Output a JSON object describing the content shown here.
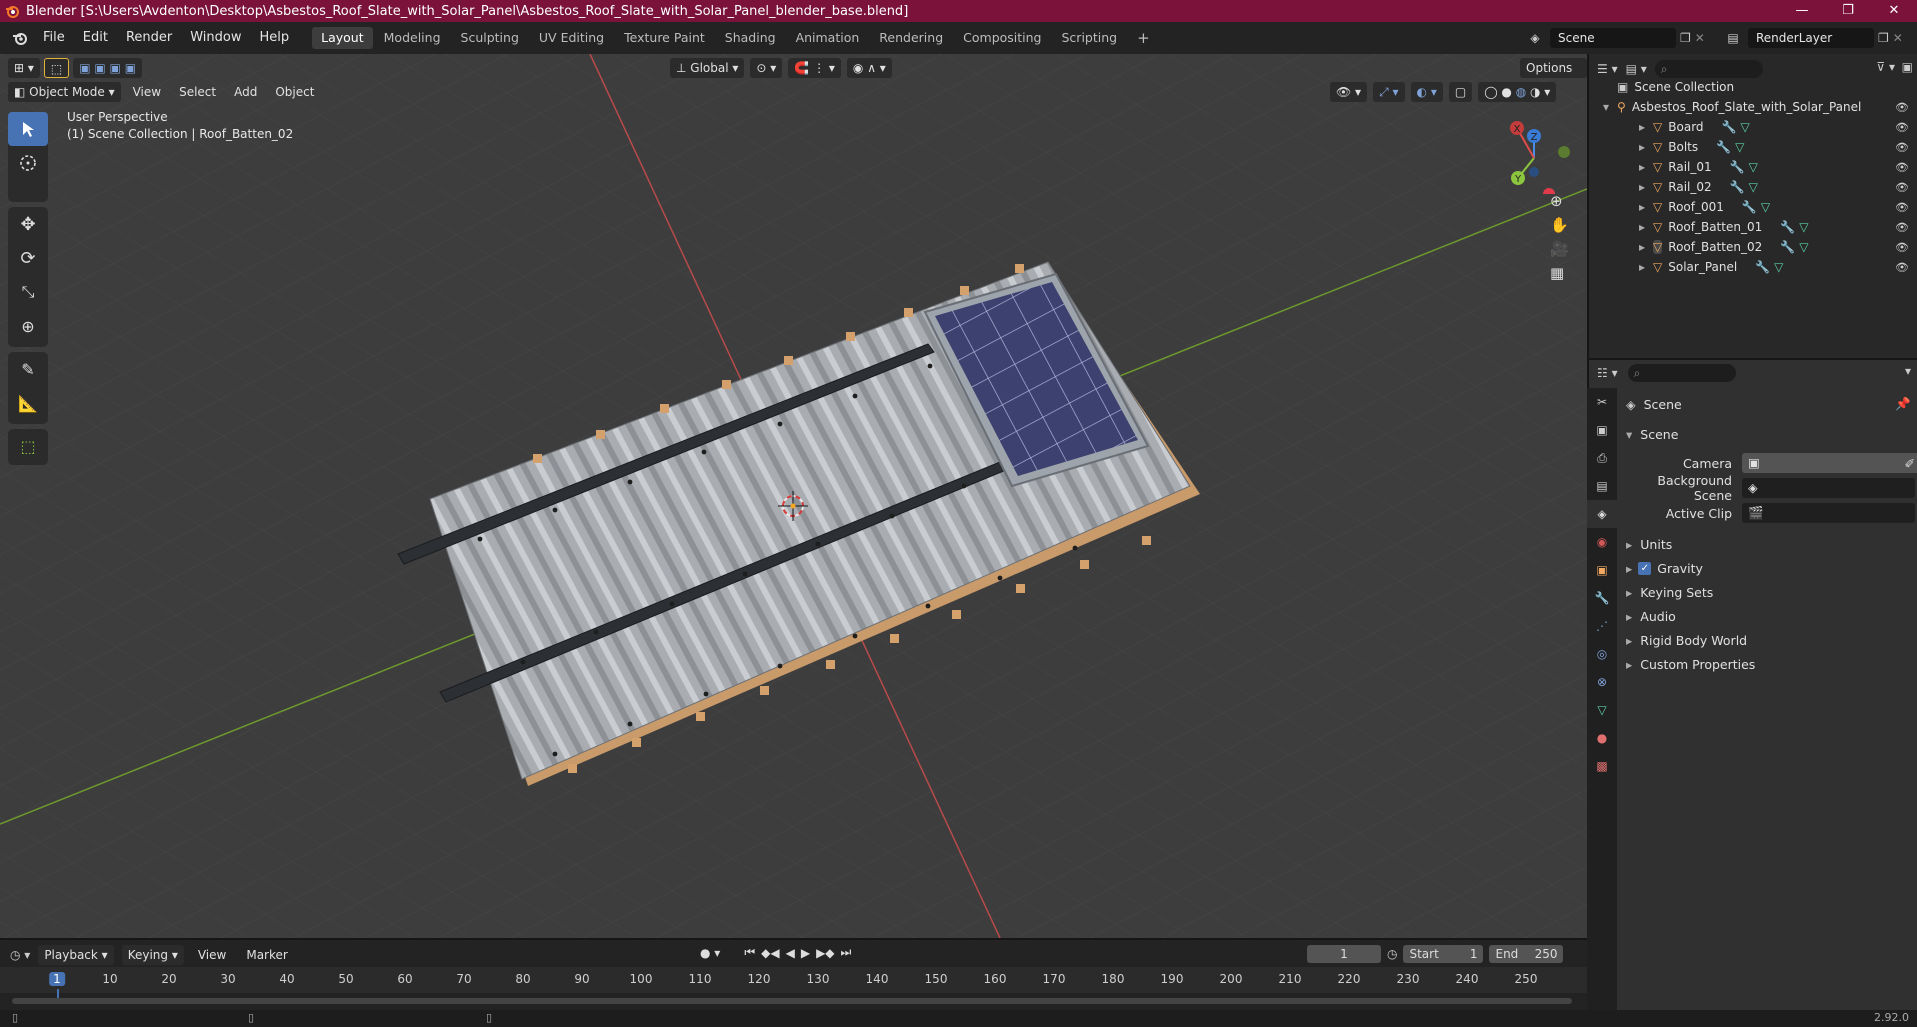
{
  "window": {
    "title": "Blender [S:\\Users\\Avdenton\\Desktop\\Asbestos_Roof_Slate_with_Solar_Panel\\Asbestos_Roof_Slate_with_Solar_Panel_blender_base.blend]",
    "controls": [
      "—",
      "❐",
      "✕"
    ]
  },
  "menubar": {
    "menus": [
      "File",
      "Edit",
      "Render",
      "Window",
      "Help"
    ],
    "workspaces": [
      "Layout",
      "Modeling",
      "Sculpting",
      "UV Editing",
      "Texture Paint",
      "Shading",
      "Animation",
      "Rendering",
      "Compositing",
      "Scripting"
    ],
    "active_workspace": "Layout",
    "add_tab": "+",
    "scene_name": "Scene",
    "view_layer": "RenderLayer"
  },
  "viewport": {
    "mode": "Object Mode",
    "menus": [
      "View",
      "Select",
      "Add",
      "Object"
    ],
    "transform_orientation": "Global",
    "options_label": "Options",
    "perspective_label": "User Perspective",
    "context_label": "(1) Scene Collection | Roof_Batten_02",
    "gizmo_axes": [
      "X",
      "Y",
      "Z"
    ]
  },
  "outliner": {
    "root": "Scene Collection",
    "collection": "Asbestos_Roof_Slate_with_Solar_Panel",
    "objects": [
      "Board",
      "Bolts",
      "Rail_01",
      "Rail_02",
      "Roof_001",
      "Roof_Batten_01",
      "Roof_Batten_02",
      "Solar_Panel"
    ],
    "selected": "Roof_Batten_02"
  },
  "properties": {
    "context": "Scene",
    "section": "Scene",
    "fields": [
      {
        "label": "Camera",
        "value": ""
      },
      {
        "label": "Background Scene",
        "value": ""
      },
      {
        "label": "Active Clip",
        "value": ""
      }
    ],
    "panels": [
      "Units",
      "Gravity",
      "Keying Sets",
      "Audio",
      "Rigid Body World",
      "Custom Properties"
    ],
    "gravity_checked": true
  },
  "timeline": {
    "menus": [
      "Playback",
      "Keying",
      "View",
      "Marker"
    ],
    "current_frame": "1",
    "start_label": "Start",
    "start": "1",
    "end_label": "End",
    "end": "250",
    "ruler": [
      "1",
      "10",
      "20",
      "30",
      "40",
      "50",
      "60",
      "70",
      "80",
      "90",
      "100",
      "110",
      "120",
      "130",
      "140",
      "150",
      "160",
      "170",
      "180",
      "190",
      "200",
      "210",
      "220",
      "230",
      "240",
      "250"
    ]
  },
  "statusbar": {
    "version": "2.92.0"
  },
  "colors": {
    "titlebar": "#7a1239",
    "accent": "#4772b3",
    "x_axis": "#e04b4b",
    "y_axis": "#8cc63f",
    "z_axis": "#4a8ee6"
  }
}
